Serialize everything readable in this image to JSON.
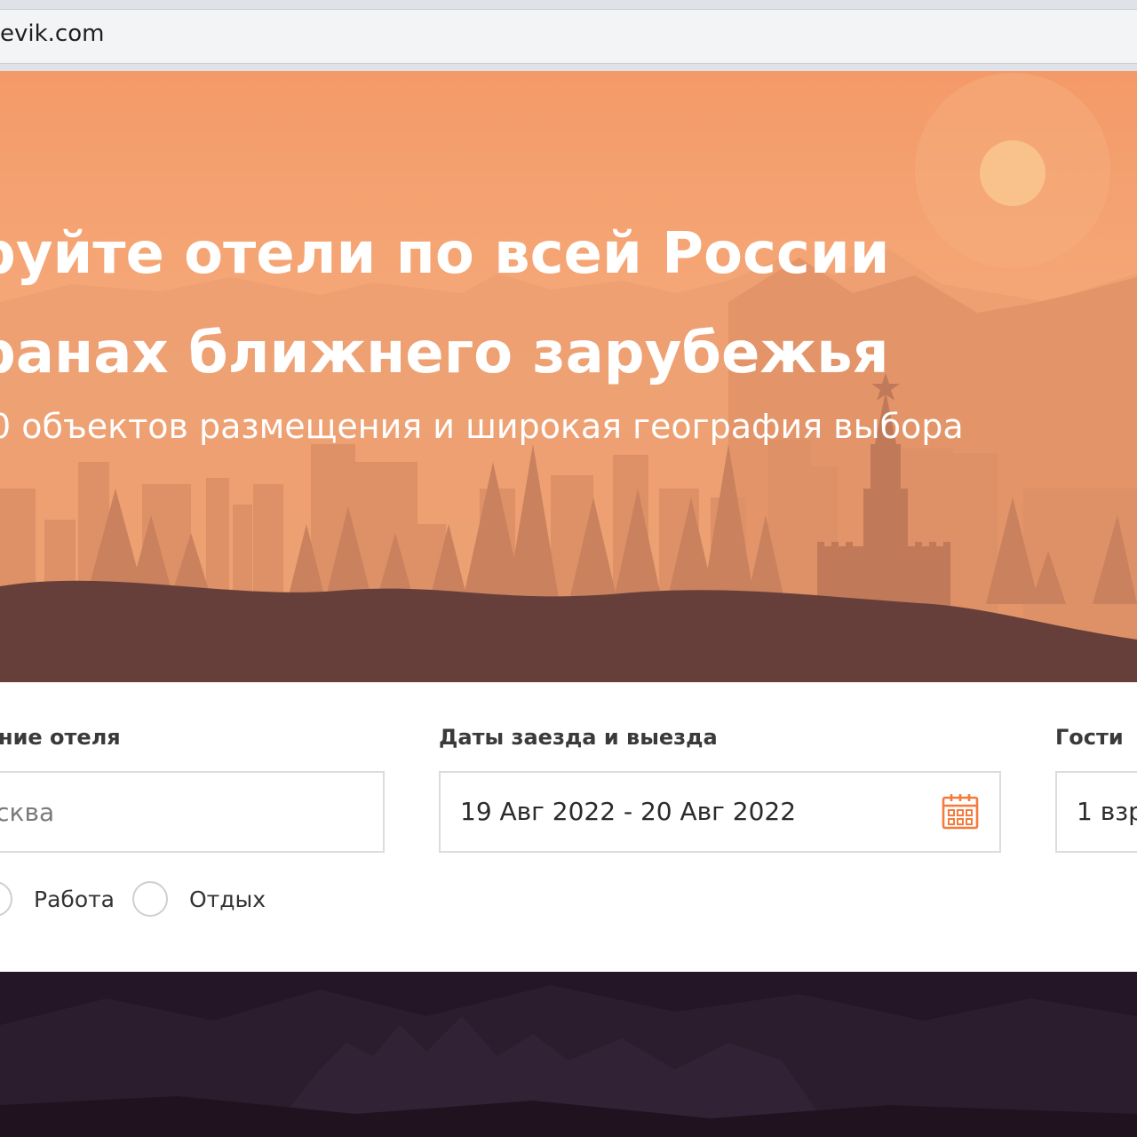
{
  "browser": {
    "address": "evik.com"
  },
  "hero": {
    "title_line1": "руйте отели по всей России",
    "title_line2": "ранах ближнего зарубежья",
    "subtitle": "0 объектов размещения и широкая география выбора"
  },
  "search": {
    "hotel_label": "ние отеля",
    "hotel_placeholder": "осква",
    "dates_label": "Даты заезда и выезда",
    "dates_value": "19 Авг 2022 - 20 Авг 2022",
    "guests_label": "Гости",
    "guests_value": "1 взр",
    "trip_purpose": [
      {
        "label": "Работа"
      },
      {
        "label": "Отдых"
      }
    ]
  },
  "colors": {
    "accent": "#f47b3b",
    "hero_top": "#f49a68",
    "ground": "#673f3a",
    "footer": "#251627"
  },
  "icons": {
    "calendar": "calendar-icon"
  }
}
